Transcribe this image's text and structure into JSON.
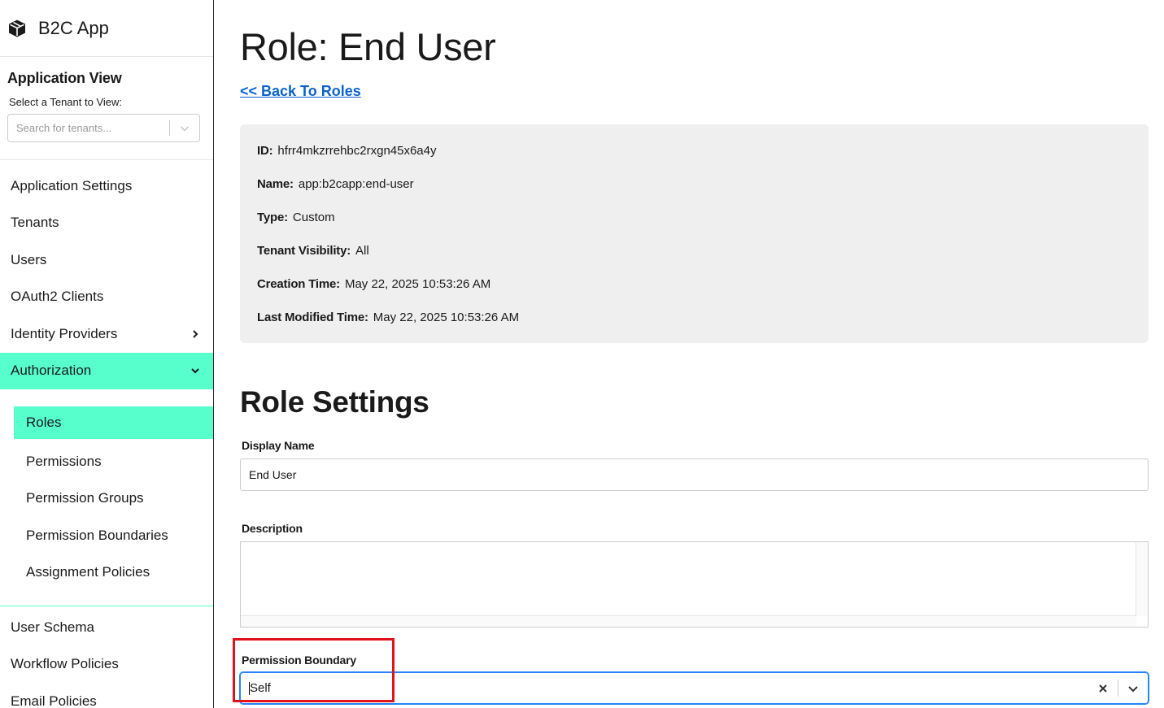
{
  "app": {
    "name": "B2C App"
  },
  "application_view": {
    "heading": "Application View",
    "tenant_label": "Select a Tenant to View:",
    "tenant_placeholder": "Search for tenants..."
  },
  "sidebar": {
    "items": [
      {
        "label": "Application Settings"
      },
      {
        "label": "Tenants"
      },
      {
        "label": "Users"
      },
      {
        "label": "OAuth2 Clients"
      },
      {
        "label": "Identity Providers"
      },
      {
        "label": "Authorization"
      }
    ],
    "authorization_sub": [
      {
        "label": "Roles"
      },
      {
        "label": "Permissions"
      },
      {
        "label": "Permission Groups"
      },
      {
        "label": "Permission Boundaries"
      },
      {
        "label": "Assignment Policies"
      }
    ],
    "bottom_items": [
      {
        "label": "User Schema"
      },
      {
        "label": "Workflow Policies"
      },
      {
        "label": "Email Policies"
      }
    ],
    "active_item": "Authorization",
    "active_sub_item": "Roles",
    "accent_color": "#57ffcc"
  },
  "page": {
    "title": "Role:  End User",
    "back_link": "<< Back To Roles"
  },
  "details": {
    "id_label": "ID:",
    "id_value": "hfrr4mkzrrehbc2rxgn45x6a4y",
    "name_label": "Name:",
    "name_value": "app:b2capp:end-user",
    "type_label": "Type:",
    "type_value": "Custom",
    "visibility_label": "Tenant Visibility:",
    "visibility_value": "All",
    "created_label": "Creation Time:",
    "created_value": "May 22, 2025 10:53:26 AM",
    "modified_label": "Last Modified Time:",
    "modified_value": "May 22, 2025 10:53:26 AM"
  },
  "role_settings": {
    "heading": "Role Settings",
    "display_name_label": "Display Name",
    "display_name_value": "End User",
    "description_label": "Description",
    "description_value": "",
    "permission_boundary_label": "Permission Boundary",
    "permission_boundary_value": "Self"
  },
  "icons": {
    "brand": "cube-icon",
    "tenant_dropdown": "chevron-down-icon",
    "identity_providers": "chevron-right-icon",
    "authorization": "chevron-down-icon",
    "clear": "close-icon",
    "boundary_dropdown": "chevron-down-icon"
  },
  "colors": {
    "link": "#0b63ce",
    "highlight": "#e0121a",
    "focus": "#2684ff"
  }
}
